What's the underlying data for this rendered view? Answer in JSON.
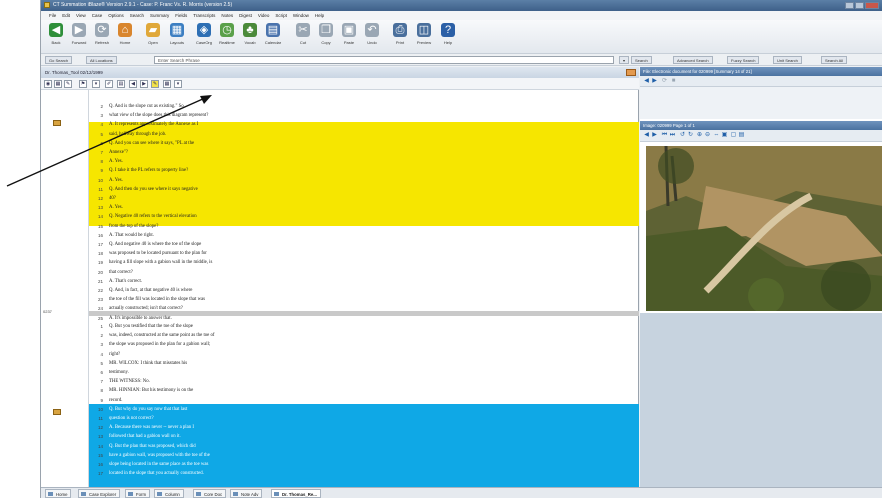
{
  "window": {
    "title": "CT Summation iBlaze® Version 2.9.1 - Case: P. Franc Vs. R. Morris (version 2.5)"
  },
  "menu": [
    "File",
    "Edit",
    "View",
    "Case",
    "Options",
    "Search",
    "Summary",
    "Fields",
    "Transcripts",
    "Notes",
    "Digest",
    "Video",
    "Script",
    "Window",
    "Help"
  ],
  "toolbar": {
    "buttons": [
      {
        "label": "Back",
        "icon": "back-arrow-icon",
        "color": "#2f8f3a"
      },
      {
        "label": "Forward",
        "icon": "forward-arrow-icon",
        "color": "#9aa7b4"
      },
      {
        "label": "Refresh",
        "icon": "refresh-icon",
        "color": "#9aa7b4"
      },
      {
        "label": "Home",
        "icon": "home-icon",
        "color": "#d9862e"
      },
      {
        "label": "Open",
        "icon": "open-folder-icon",
        "color": "#e0a83a"
      },
      {
        "label": "Layouts",
        "icon": "layouts-icon",
        "color": "#3d7fc2"
      },
      {
        "label": "CaseOrg",
        "icon": "caseorg-icon",
        "color": "#2e6fb4"
      },
      {
        "label": "Realtime",
        "icon": "realtime-icon",
        "color": "#5aa04a"
      },
      {
        "label": "Vocab",
        "icon": "vocab-icon",
        "color": "#4b8a3a"
      },
      {
        "label": "Calendar",
        "icon": "calendar-icon",
        "color": "#4a73ad"
      },
      {
        "label": "Cut",
        "icon": "cut-icon",
        "color": "#9aa7b4"
      },
      {
        "label": "Copy",
        "icon": "copy-icon",
        "color": "#9aa7b4"
      },
      {
        "label": "Paste",
        "icon": "paste-icon",
        "color": "#9aa7b4"
      },
      {
        "label": "Undo",
        "icon": "undo-icon",
        "color": "#9aa7b4"
      },
      {
        "label": "Print",
        "icon": "print-icon",
        "color": "#4a6f9c"
      },
      {
        "label": "Preview",
        "icon": "preview-icon",
        "color": "#4a6f9c"
      },
      {
        "label": "Help",
        "icon": "help-icon",
        "color": "#2b5fa6"
      }
    ]
  },
  "search": {
    "placeholder": "Enter Search Phrase",
    "left_buttons": [
      "Go Search",
      "All Locations"
    ],
    "right_buttons": [
      "Search",
      "Advanced Search",
      "Fuzzy Search",
      "Unit Search",
      "Search All"
    ]
  },
  "transcript_pane": {
    "title": "Dr. Thomas_Tool 02/12/1999",
    "page_label": "0237",
    "page1": [
      {
        "n": "2",
        "t": "     Q.     And is the slope cut as existing.\" So"
      },
      {
        "n": "3",
        "t": "what view of the slope does this diagram represent?"
      },
      {
        "n": "4",
        "t": "     A.     It represents approximately the Annexe as I"
      },
      {
        "n": "5",
        "t": "said, halfway through the job."
      },
      {
        "n": "6",
        "t": "     Q.     And you can see where it says, \"PL at the"
      },
      {
        "n": "7",
        "t": "Annexe\"?"
      },
      {
        "n": "8",
        "t": "     A.     Yes."
      },
      {
        "n": "9",
        "t": "     Q.     I take it the PL refers to property line?"
      },
      {
        "n": "10",
        "t": "     A.     Yes."
      },
      {
        "n": "11",
        "t": "     Q.     And then do you see where it says negative"
      },
      {
        "n": "12",
        "t": "40?"
      },
      {
        "n": "13",
        "t": "     A.     Yes."
      },
      {
        "n": "14",
        "t": "     Q.     Negative 40 refers to the vertical elevation"
      },
      {
        "n": "15",
        "t": "from the top of the slope?"
      },
      {
        "n": "16",
        "t": "     A.     That would be right."
      },
      {
        "n": "17",
        "t": "     Q.     And negative 40 is where the toe of the slope"
      },
      {
        "n": "18",
        "t": "was proposed to be located pursuant to the plan for"
      },
      {
        "n": "19",
        "t": "having a fill slope with a gabion wall in the middle, is"
      },
      {
        "n": "20",
        "t": "that correct?"
      },
      {
        "n": "21",
        "t": "     A.     That's correct."
      },
      {
        "n": "22",
        "t": "     Q.     And, in fact, at that negative 40 is where"
      },
      {
        "n": "23",
        "t": "the toe of the fill was located in the slope that was"
      },
      {
        "n": "24",
        "t": "actually constructed; isn't that correct?"
      },
      {
        "n": "25",
        "t": "     A.     It's impossible to answer that."
      }
    ],
    "page2": [
      {
        "n": "1",
        "t": "     Q.     But you testified that the toe of the slope"
      },
      {
        "n": "2",
        "t": "was, indeed, constructed at the same point as the toe of"
      },
      {
        "n": "3",
        "t": "the slope was proposed in the plan for a gabion wall;"
      },
      {
        "n": "4",
        "t": "right?"
      },
      {
        "n": "5",
        "t": "          MR. WILCOX:  I think that misstates his"
      },
      {
        "n": "6",
        "t": "testimony."
      },
      {
        "n": "7",
        "t": "          THE WITNESS:  No."
      },
      {
        "n": "8",
        "t": "          MR. HINNIAN:  But his testimony is on the"
      },
      {
        "n": "9",
        "t": "record."
      },
      {
        "n": "10",
        "t": "     Q.     But why do you say now that that last"
      },
      {
        "n": "11",
        "t": "question is not correct?"
      },
      {
        "n": "12",
        "t": "     A.     Because there was never -- never a plan I"
      },
      {
        "n": "13",
        "t": "followed that had a gabion wall on it."
      },
      {
        "n": "14",
        "t": "     Q.     But the plan that was proposed, which did"
      },
      {
        "n": "15",
        "t": "have a gabion wall, was proposed with the toe of the"
      },
      {
        "n": "16",
        "t": "slope being located in the same place as the toe was"
      },
      {
        "n": "17",
        "t": "located in the slope that you actually constructed."
      }
    ]
  },
  "right_pane": {
    "top_title": "File: Electronic document for 020999 [Summary 14 of 21]",
    "image_title": "Image: 020999 Page 1 of 1"
  },
  "statusbar": {
    "tabs": [
      "Home",
      "Case Explorer",
      "Form",
      "Column",
      "Core Doc",
      "Note Adv",
      "Dr. Thomas_Re..."
    ]
  },
  "colors": {
    "highlight_yellow": "#f6e600",
    "highlight_blue": "#0fa8e6",
    "accent": "#3e6089"
  }
}
